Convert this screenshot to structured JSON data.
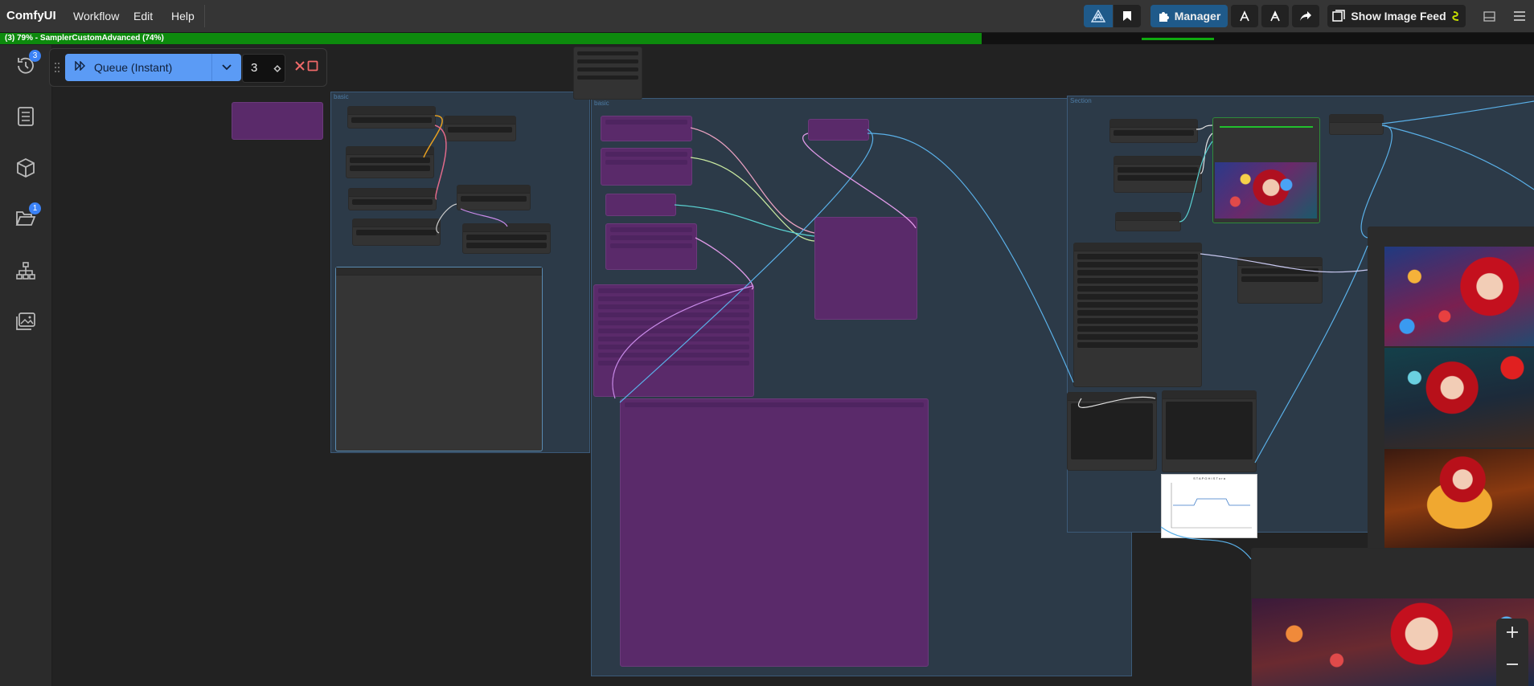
{
  "app": {
    "logo": "ComfyUI",
    "menu": [
      "Workflow",
      "Edit",
      "Help"
    ]
  },
  "toolbar": {
    "manager_label": "Manager",
    "show_feed_label": "Show Image Feed",
    "accent": "#1f5a8a"
  },
  "progress": {
    "text": "(3) 79% - SamplerCustomAdvanced (74%)",
    "overall_percent": 79,
    "node_percent": 74,
    "color": "#0d8a0d"
  },
  "sidebar": {
    "items": [
      {
        "icon": "history-icon",
        "badge": "3"
      },
      {
        "icon": "document-icon",
        "badge": ""
      },
      {
        "icon": "cube-icon",
        "badge": ""
      },
      {
        "icon": "folder-open-icon",
        "badge": "1"
      },
      {
        "icon": "node-tree-icon",
        "badge": ""
      },
      {
        "icon": "images-icon",
        "badge": ""
      }
    ]
  },
  "queue": {
    "label": "Queue (Instant)",
    "count": "3",
    "accent": "#5b9bf5"
  },
  "groups": [
    {
      "title": "basic"
    },
    {
      "title": "basic"
    },
    {
      "title": "Section"
    }
  ],
  "chart_thumb": {
    "title": "S T A P G H I S T o r a"
  }
}
